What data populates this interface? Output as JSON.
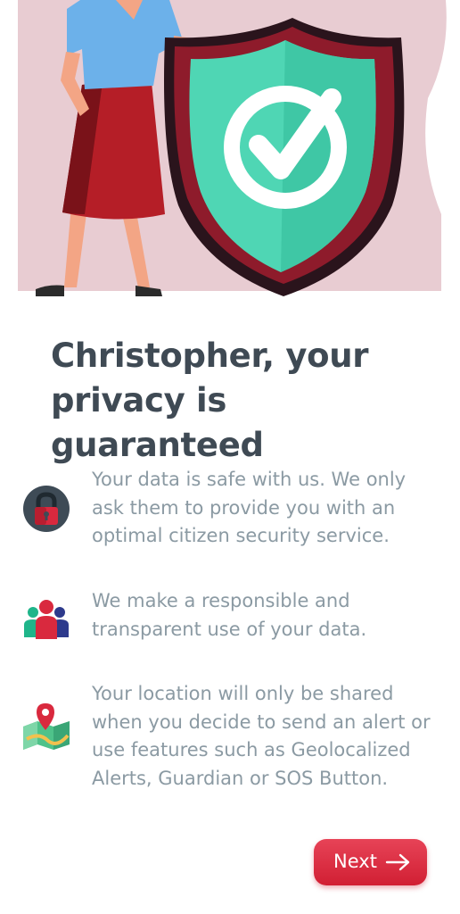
{
  "title": "Christopher, your privacy is guaranteed",
  "items": [
    {
      "icon": "padlock-icon",
      "text": "Your data is safe with us. We only ask them to provide you with an optimal citizen security service."
    },
    {
      "icon": "people-group-icon",
      "text": "We make a responsible and transparent use of your data."
    },
    {
      "icon": "map-pin-icon",
      "text": "Your location will only be shared when you decide to send an alert or use features such as Geolocalized Alerts, Guardian or SOS Button."
    }
  ],
  "next_button": {
    "label": "Next"
  },
  "colors": {
    "accent": "#d9293e",
    "title": "#3f4a54",
    "body_text": "#8b9aa3",
    "hero_bg": "#e8ccd2",
    "shield": "#4fd6b4"
  }
}
